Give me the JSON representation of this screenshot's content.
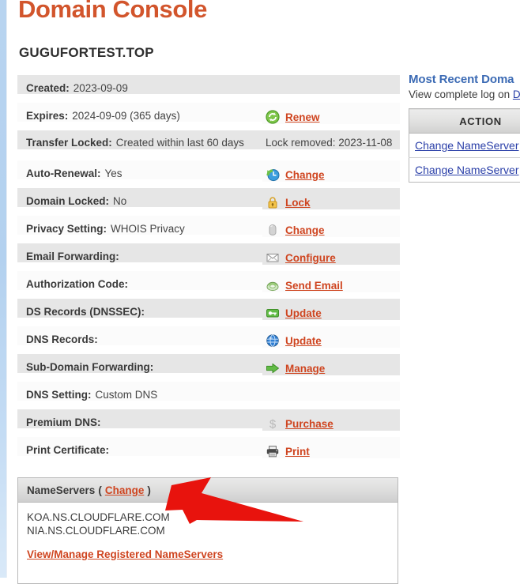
{
  "header": {
    "console_title": "Domain Console",
    "domain_name": "GUGUFORTEST.TOP"
  },
  "details": {
    "rows": [
      {
        "label": "Created:",
        "value": "2023-09-09",
        "note": "",
        "icon": "",
        "action": ""
      },
      {
        "label": "Expires:",
        "value": "2024-09-09 (365 days)",
        "note": "",
        "icon": "renew-icon",
        "action": "Renew"
      },
      {
        "label": "Transfer Locked:",
        "value": "Created within last 60 days",
        "note": "Lock removed: 2023-11-08",
        "icon": "",
        "action": ""
      },
      {
        "label": "Auto-Renewal:",
        "value": "Yes",
        "note": "",
        "icon": "clock-icon",
        "action": "Change"
      },
      {
        "label": "Domain Locked:",
        "value": "No",
        "note": "",
        "icon": "padlock-icon",
        "action": "Lock"
      },
      {
        "label": "Privacy Setting:",
        "value": "WHOIS Privacy",
        "note": "",
        "icon": "privacy-icon",
        "action": "Change"
      },
      {
        "label": "Email Forwarding:",
        "value": "",
        "note": "",
        "icon": "envelope-icon",
        "action": "Configure"
      },
      {
        "label": "Authorization Code:",
        "value": "",
        "note": "",
        "icon": "mail-send-icon",
        "action": "Send Email"
      },
      {
        "label": "DS Records (DNSSEC):",
        "value": "",
        "note": "",
        "icon": "key-icon",
        "action": "Update"
      },
      {
        "label": "DNS Records:",
        "value": "",
        "note": "",
        "icon": "globe-icon",
        "action": "Update"
      },
      {
        "label": "Sub-Domain Forwarding:",
        "value": "",
        "note": "",
        "icon": "arrow-right-icon",
        "action": "Manage"
      },
      {
        "label": "DNS Setting:",
        "value": "Custom DNS",
        "note": "",
        "icon": "",
        "action": ""
      },
      {
        "label": "Premium DNS:",
        "value": "",
        "note": "",
        "icon": "dollar-icon",
        "action": "Purchase"
      },
      {
        "label": "Print Certificate:",
        "value": "",
        "note": "",
        "icon": "printer-icon",
        "action": "Print"
      }
    ]
  },
  "nameservers": {
    "title": "NameServers",
    "open_paren": "(",
    "change_label": "Change",
    "close_paren": ")",
    "servers": [
      "KOA.NS.CLOUDFLARE.COM",
      "NIA.NS.CLOUDFLARE.COM"
    ],
    "manage_label": "View/Manage Registered NameServers"
  },
  "side_panel": {
    "title": "Most Recent Doma",
    "subtitle_prefix": "View complete log on ",
    "subtitle_link": "D",
    "column_header": "ACTION",
    "rows": [
      "Change NameServer",
      "Change NameServer"
    ]
  },
  "colors": {
    "title_orange": "#d2552c",
    "link_orange": "#cf4520",
    "side_blue": "#3b6ab4",
    "side_link_blue": "#2a3fa8",
    "arrow_red": "#e8130d",
    "row_shaded": "#e6e6e6",
    "row_plain": "#fbfbfb"
  }
}
